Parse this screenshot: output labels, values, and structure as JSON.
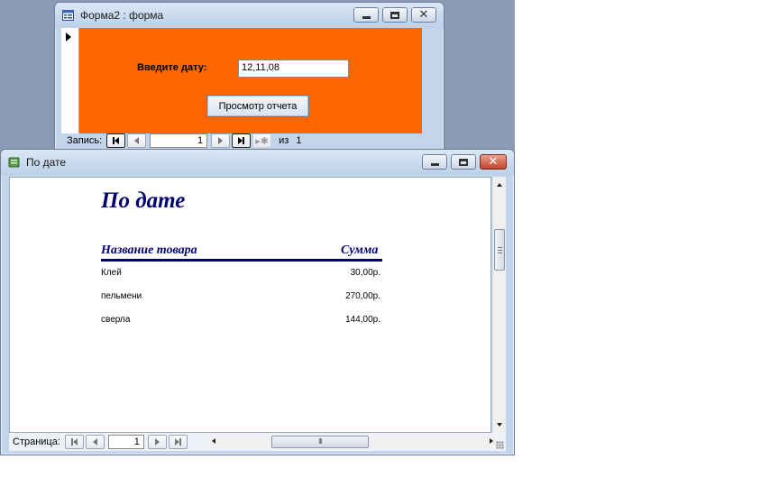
{
  "form_window": {
    "title": "Форма2 : форма",
    "date_label": "Введите дату:",
    "date_value": "12,11,08",
    "report_button_label": "Просмотр отчета",
    "nav": {
      "record_label": "Запись:",
      "current": "1",
      "of_label": "из",
      "total": "1"
    }
  },
  "report_window": {
    "title": "По дате",
    "report_title": "По дате",
    "columns": {
      "name": "Название товара",
      "sum": "Сумма"
    },
    "rows": [
      {
        "name": "Клей",
        "sum": "30,00р."
      },
      {
        "name": "пельмени",
        "sum": "270,00р."
      },
      {
        "name": "сверла",
        "sum": "144,00р."
      }
    ],
    "nav": {
      "page_label": "Страница:",
      "current": "1"
    },
    "scroll_grip": "III"
  },
  "colors": {
    "form_background": "#ff6600",
    "report_heading": "#00006e",
    "desktop": "#8b9bb6"
  },
  "icons": [
    "form-window-icon",
    "report-window-icon",
    "minimize-icon",
    "maximize-icon",
    "close-icon",
    "record-pointer-icon",
    "first-record-icon",
    "previous-record-icon",
    "next-record-icon",
    "last-record-icon",
    "new-record-icon"
  ]
}
